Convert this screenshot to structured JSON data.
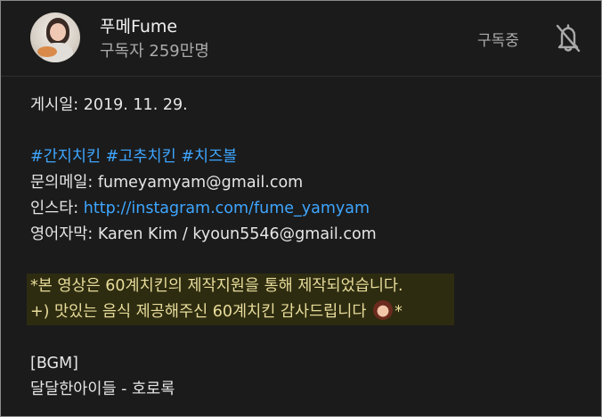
{
  "channel": {
    "name": "푸메Fume",
    "subscribers": "구독자 259만명",
    "subscribe_status": "구독중"
  },
  "description": {
    "date": "게시일: 2019. 11. 29.",
    "hashtags": [
      "#간지치킨",
      "#고추치킨",
      "#치즈볼"
    ],
    "email_label": "문의메일: ",
    "email": "fumeyamyam@gmail.com",
    "insta_label": "인스타: ",
    "insta_url": "http://instagram.com/fume_yamyam",
    "subtitle_label": "영어자막: ",
    "subtitle_credit": "Karen Kim / kyoun5546@gmail.com",
    "sponsor_line1": "*본 영상은 60계치킨의 제작지원을 통해 제작되었습니다.",
    "sponsor_line2_text": "+) 맛있는 음식 제공해주신 60계치킨 감사드립니다",
    "sponsor_line2_end": "*",
    "bgm_label": "[BGM]",
    "bgm_track": "달달한아이들 - 호로록"
  },
  "icons": {
    "avatar": "channel-avatar",
    "bell": "bell-off-icon",
    "emoji": "face-emoji"
  }
}
